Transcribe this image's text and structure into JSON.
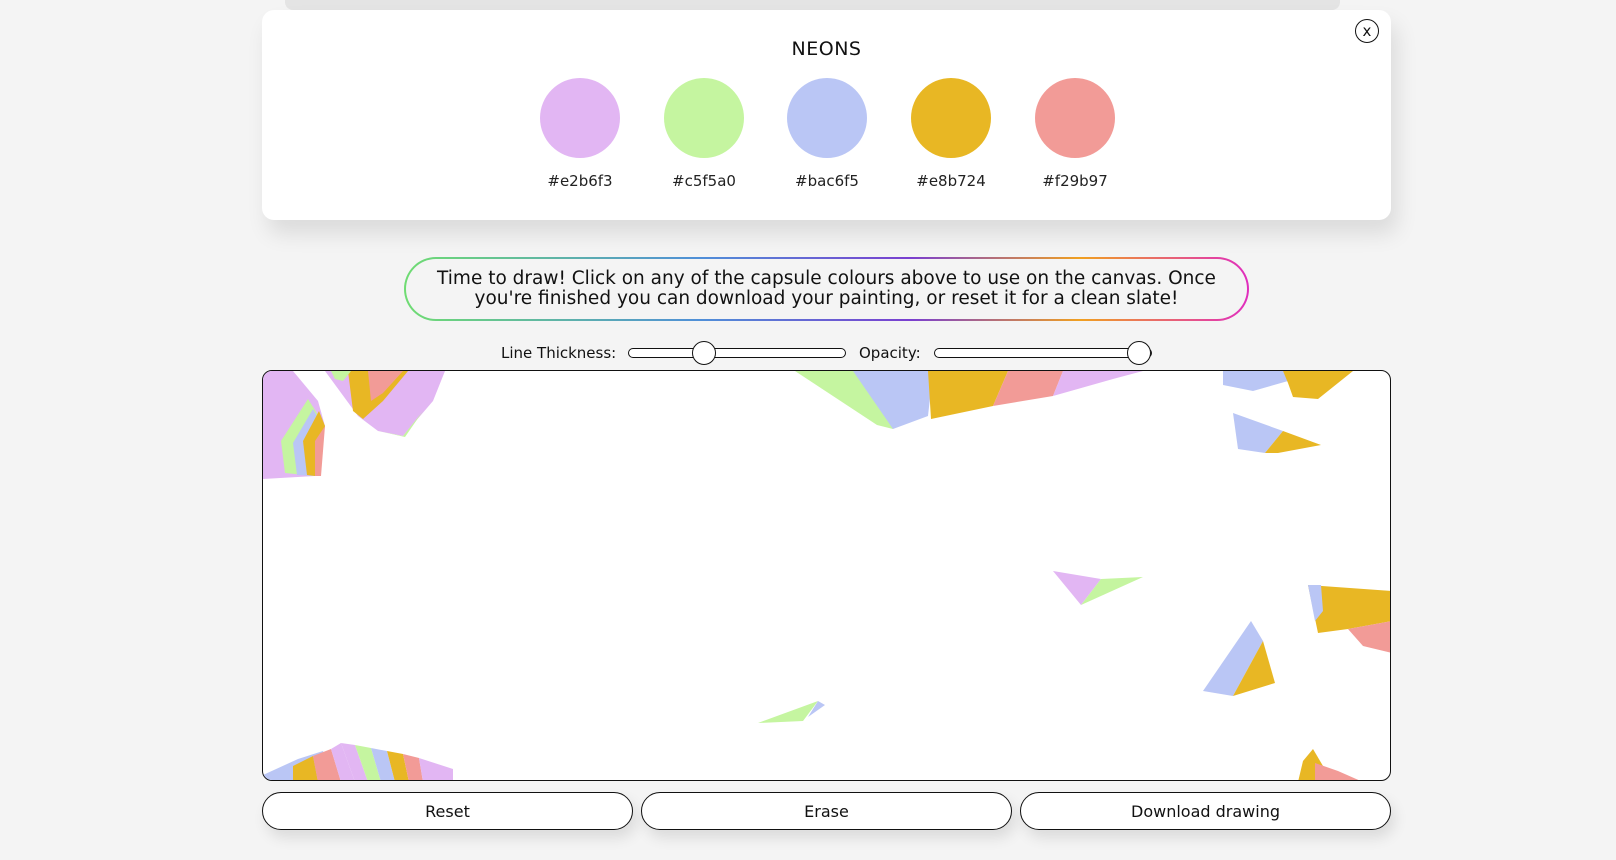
{
  "palette": {
    "title": "NEONS",
    "close_label": "x",
    "colors": [
      {
        "hex": "#e2b6f3",
        "label": "#e2b6f3"
      },
      {
        "hex": "#c5f5a0",
        "label": "#c5f5a0"
      },
      {
        "hex": "#bac6f5",
        "label": "#bac6f5"
      },
      {
        "hex": "#e8b724",
        "label": "#e8b724"
      },
      {
        "hex": "#f29b97",
        "label": "#f29b97"
      }
    ]
  },
  "message": {
    "line1": "Time to draw! Click on any of the capsule colours above to use on the canvas. Once",
    "line2": "you're finished you can download your painting, or reset it for a clean slate!"
  },
  "controls": {
    "thickness_label": "Line Thickness:",
    "thickness_value": 0.33,
    "opacity_label": "Opacity:",
    "opacity_value": 1.0
  },
  "buttons": {
    "reset_label": "Reset",
    "erase_label": "Erase",
    "download_label": "Download drawing"
  }
}
